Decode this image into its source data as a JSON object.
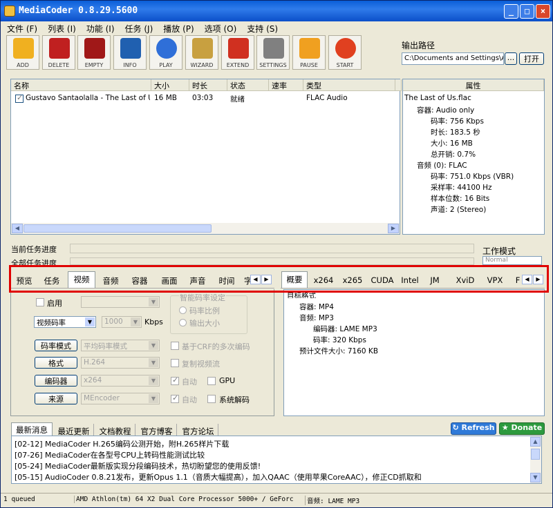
{
  "window": {
    "title": "MediaCoder 0.8.29.5600"
  },
  "menu": [
    "文件 (F)",
    "列表 (I)",
    "功能 (I)",
    "任务 (J)",
    "播放 (P)",
    "选项 (O)",
    "支持 (S)"
  ],
  "toolbar": [
    {
      "label": "ADD",
      "icon": "add-icon",
      "color": "#f0b020"
    },
    {
      "label": "DELETE",
      "icon": "delete-icon",
      "color": "#c02020"
    },
    {
      "label": "EMPTY",
      "icon": "empty-icon",
      "color": "#a01818"
    },
    {
      "label": "INFO",
      "icon": "info-icon",
      "color": "#2060b0"
    },
    {
      "label": "PLAY",
      "icon": "play-icon",
      "color": "#2f6fd8"
    },
    {
      "label": "WIZARD",
      "icon": "wizard-icon",
      "color": "#c8a040"
    },
    {
      "label": "EXTEND",
      "icon": "extend-icon",
      "color": "#d03020"
    },
    {
      "label": "SETTINGS",
      "icon": "settings-icon",
      "color": "#808080"
    },
    {
      "label": "PAUSE",
      "icon": "pause-icon",
      "color": "#f0a020"
    },
    {
      "label": "START",
      "icon": "start-icon",
      "color": "#e04020"
    }
  ],
  "output": {
    "label": "输出路径",
    "path": "C:\\Documents and Settings\\A",
    "browse": "...",
    "open": "打开"
  },
  "filelist": {
    "columns": [
      "名称",
      "大小",
      "时长",
      "状态",
      "速率",
      "类型"
    ],
    "rows": [
      {
        "name": "Gustavo Santaolalla - The Last of Us",
        "size": "16 MB",
        "duration": "03:03",
        "status": "就绪",
        "rate": "",
        "type": "FLAC Audio"
      }
    ]
  },
  "properties": {
    "header": "属性",
    "lines": [
      "The Last of Us.flac",
      "容器: Audio only",
      "码率: 756 Kbps",
      "时长: 183.5 秒",
      "大小: 16 MB",
      "总开销: 0.7%",
      "音频 (0): FLAC",
      "码率: 751.0 Kbps (VBR)",
      "采样率: 44100 Hz",
      "样本位数: 16 Bits",
      "声道: 2 (Stereo)"
    ]
  },
  "progress": {
    "current": "当前任务进度",
    "all": "全部任务进度"
  },
  "workmode": {
    "label": "工作模式",
    "value": "Normal"
  },
  "left_tabs": [
    "预览",
    "任务",
    "视频",
    "音频",
    "容器",
    "画面",
    "声音",
    "时间",
    "字"
  ],
  "right_tabs": [
    "概要",
    "x264",
    "x265",
    "CUDA",
    "Intel",
    "JM",
    "XviD",
    "VPX",
    "F"
  ],
  "video": {
    "enable": "启用",
    "mode": "视频码率",
    "bitrate": "1000",
    "unit": "Kbps",
    "ratecontrol_btn": "码率模式",
    "ratecontrol_val": "平均码率模式",
    "format_btn": "格式",
    "format_val": "H.264",
    "encoder_btn": "编码器",
    "encoder_val": "x264",
    "source_btn": "来源",
    "source_val": "MEncoder",
    "smart_group": "智能码率设定",
    "ratio": "码率比例",
    "outsize": "输出大小",
    "crf": "基于CRF的多次编码",
    "copy": "复制视频流",
    "auto1": "自动",
    "gpu": "GPU",
    "auto2": "自动",
    "sysdecode": "系统解码"
  },
  "summary": [
    "目标格式",
    "容器: MP4",
    "音频: MP3",
    "编码器: LAME MP3",
    "码率: 320 Kbps",
    "预计文件大小: 7160 KB"
  ],
  "news_tabs": [
    "最新消息",
    "最近更新",
    "文档教程",
    "官方博客",
    "官方论坛"
  ],
  "refresh": "Refresh",
  "donate": "Donate",
  "news": [
    "[02-12] MediaCoder H.265编码公测开始，附H.265样片下载",
    "[07-26] MediaCoder在各型号CPU上转码性能测试比较",
    "[05-24] MediaCoder最新版实现分段编码技术，热切盼望您的使用反馈!",
    "[05-15] AudioCoder 0.8.21发布，更新Opus 1.1（音质大幅提高），加入QAAC（使用苹果CoreAAC），修正CD抓取和"
  ],
  "status": {
    "queued": "1 queued",
    "cpu": "AMD Athlon(tm) 64 X2 Dual Core Processor 5000+ / GeForc",
    "audio": "音频: LAME MP3"
  }
}
